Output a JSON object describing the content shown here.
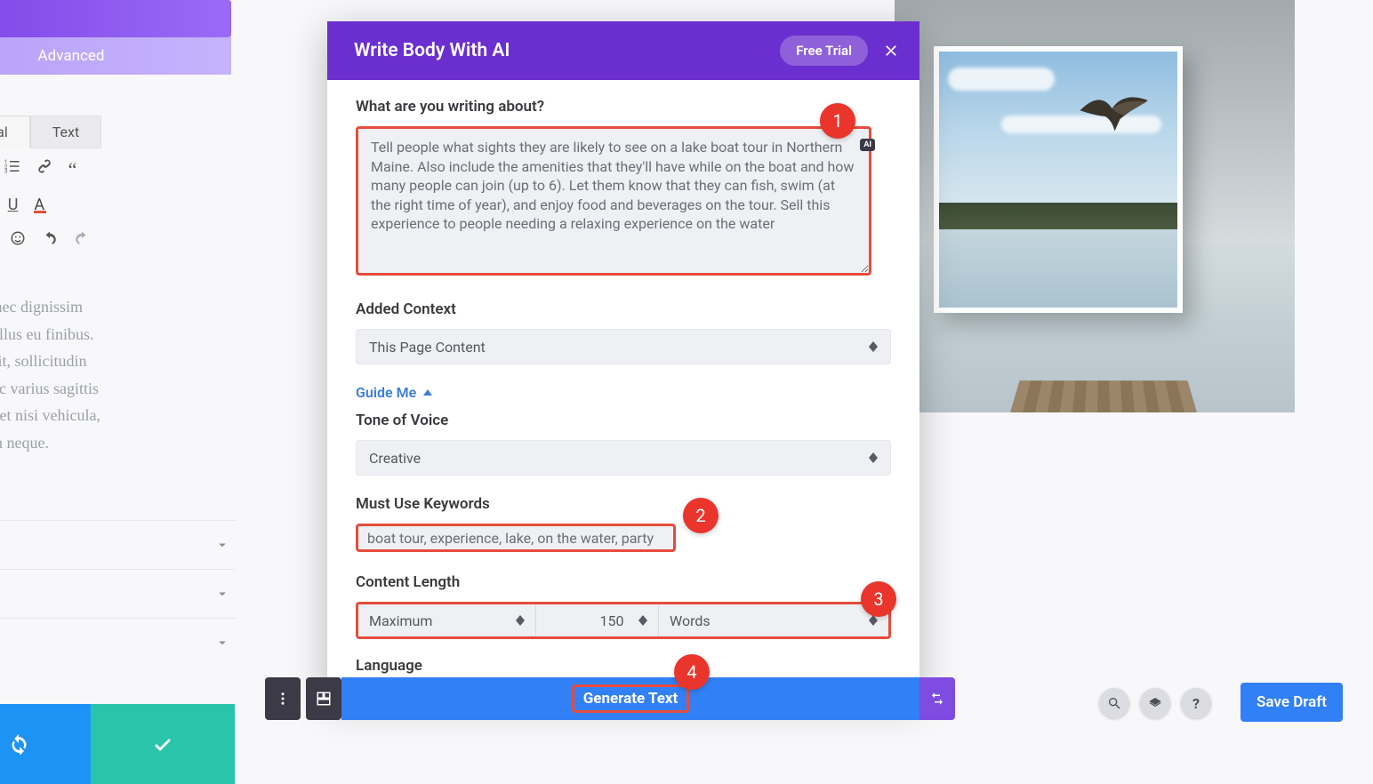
{
  "left_panel": {
    "advanced_tab": "Advanced",
    "visual_tab": "Visual",
    "text_tab": "Text",
    "body_text": "t nunc, nec dignissim\ns eget tellus eu finibus.\ne suscipit, sollicitudin\nrat. Nunc varius sagittis\nAenean et nisi vehicula,\nccumsan neque."
  },
  "modal": {
    "title": "Write Body With AI",
    "free_trial": "Free Trial",
    "prompt_label": "What are you writing about?",
    "prompt_value": "Tell people what sights they are likely to see on a lake boat tour in Northern Maine. Also include the amenities that they'll have while on the boat and how many people can join (up to 6). Let them know that they can fish, swim (at the right time of year), and enjoy food and beverages on the tour. Sell this experience to people needing a relaxing experience on the water",
    "ai_badge": "AI",
    "context_label": "Added Context",
    "context_value": "This Page Content",
    "guide_me": "Guide Me",
    "tone_label": "Tone of Voice",
    "tone_value": "Creative",
    "keywords_label": "Must Use Keywords",
    "keywords_value": "boat tour, experience, lake, on the water, party",
    "length_label": "Content Length",
    "length_mode": "Maximum",
    "length_value": "150",
    "length_unit": "Words",
    "language_label": "Language"
  },
  "bottom": {
    "generate": "Generate Text",
    "save_draft": "Save Draft",
    "help": "?"
  },
  "annotations": {
    "a1": "1",
    "a2": "2",
    "a3": "3",
    "a4": "4"
  }
}
